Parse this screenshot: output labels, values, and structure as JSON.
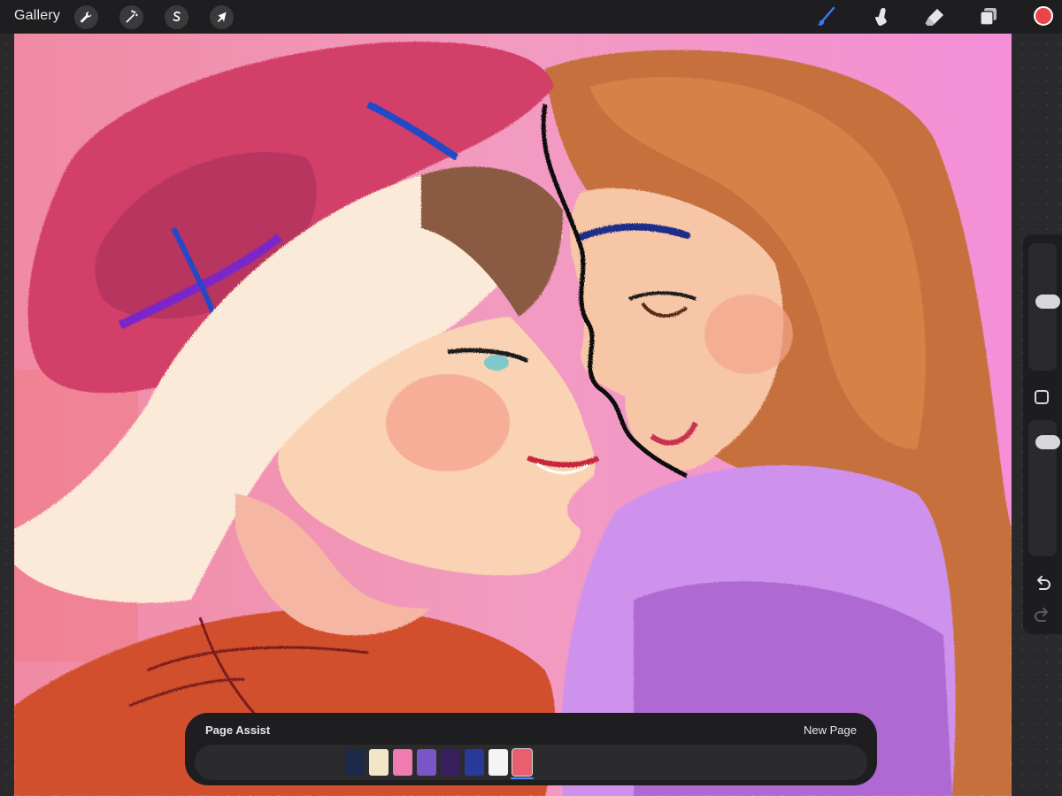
{
  "topbar": {
    "gallery_label": "Gallery",
    "left_tools": [
      {
        "name": "actions",
        "icon": "wrench-icon"
      },
      {
        "name": "adjustments",
        "icon": "magic-wand-icon"
      },
      {
        "name": "selection",
        "icon": "selection-s-icon"
      },
      {
        "name": "transform",
        "icon": "arrow-cursor-icon"
      }
    ],
    "right_tools": [
      {
        "name": "brush",
        "icon": "brush-icon",
        "active": true
      },
      {
        "name": "smudge",
        "icon": "smudge-finger-icon",
        "active": false
      },
      {
        "name": "eraser",
        "icon": "eraser-icon",
        "active": false
      },
      {
        "name": "layers",
        "icon": "layers-icon",
        "active": false
      }
    ],
    "current_color": "#e8464a",
    "accent_color": "#3d7bf5"
  },
  "sidebar": {
    "size_slider": 0.55,
    "opacity_slider": 0.88,
    "icons": [
      "modify-square-icon",
      "undo-icon",
      "redo-icon"
    ]
  },
  "page_assist": {
    "title": "Page Assist",
    "new_page_label": "New Page",
    "page_count": 8,
    "active_page": 8,
    "thumbnail_colors": [
      "#1b2a4a",
      "#f2e6c9",
      "#f07bb0",
      "#7a55c8",
      "#3a1f5e",
      "#2a3a9a",
      "#f4f4f4",
      "#e86070"
    ]
  }
}
